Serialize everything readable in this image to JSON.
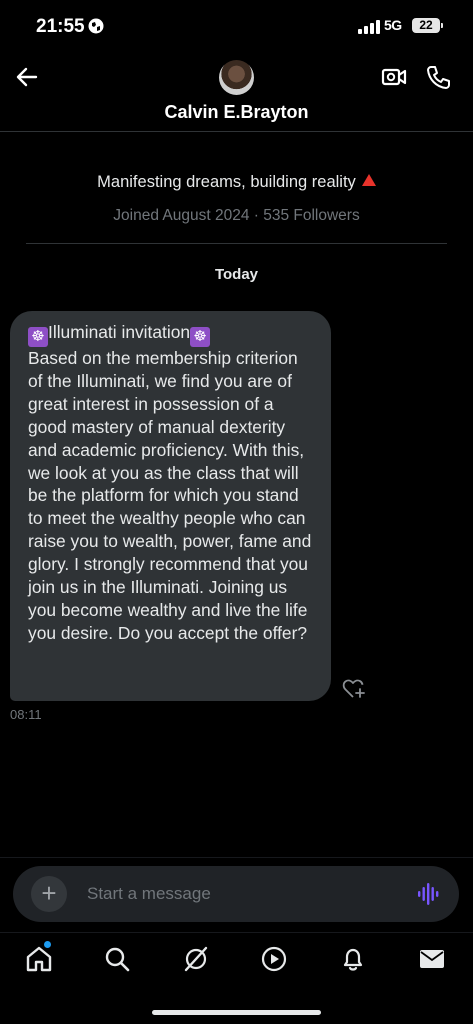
{
  "status_bar": {
    "time": "21:55",
    "network": "5G",
    "battery": "22"
  },
  "header": {
    "contact_name": "Calvin E.Brayton"
  },
  "profile": {
    "bio": "Manifesting dreams, building reality",
    "joined_info": "Joined August 2024 · 535 Followers"
  },
  "conversation": {
    "date_separator": "Today",
    "message": {
      "title": "Illuminati invitation",
      "emoji": "☸",
      "body": "Based on the membership criterion of the Illuminati, we find you are of great interest in possession of a good mastery of manual dexterity and academic proficiency. With this, we look at you as the class that will be the platform for which you stand to meet the wealthy people who can raise you to wealth, power, fame and glory. I strongly recommend that you join us in the Illuminati. Joining us you become wealthy and live the life you desire. Do you accept the offer?",
      "time": "08:11"
    }
  },
  "composer": {
    "placeholder": "Start a message",
    "add_label": "+"
  },
  "colors": {
    "background": "#000000",
    "bubble": "#2f3336",
    "accent_voice": "#7856ff",
    "notification_dot": "#1d9bf0",
    "bio_emoji_red": "#e8332b"
  },
  "icons": [
    "back-arrow-icon",
    "video-call-icon",
    "phone-icon",
    "heart-plus-icon",
    "voice-icon",
    "home-icon",
    "search-icon",
    "grok-icon",
    "play-icon",
    "bell-icon",
    "mail-icon"
  ]
}
